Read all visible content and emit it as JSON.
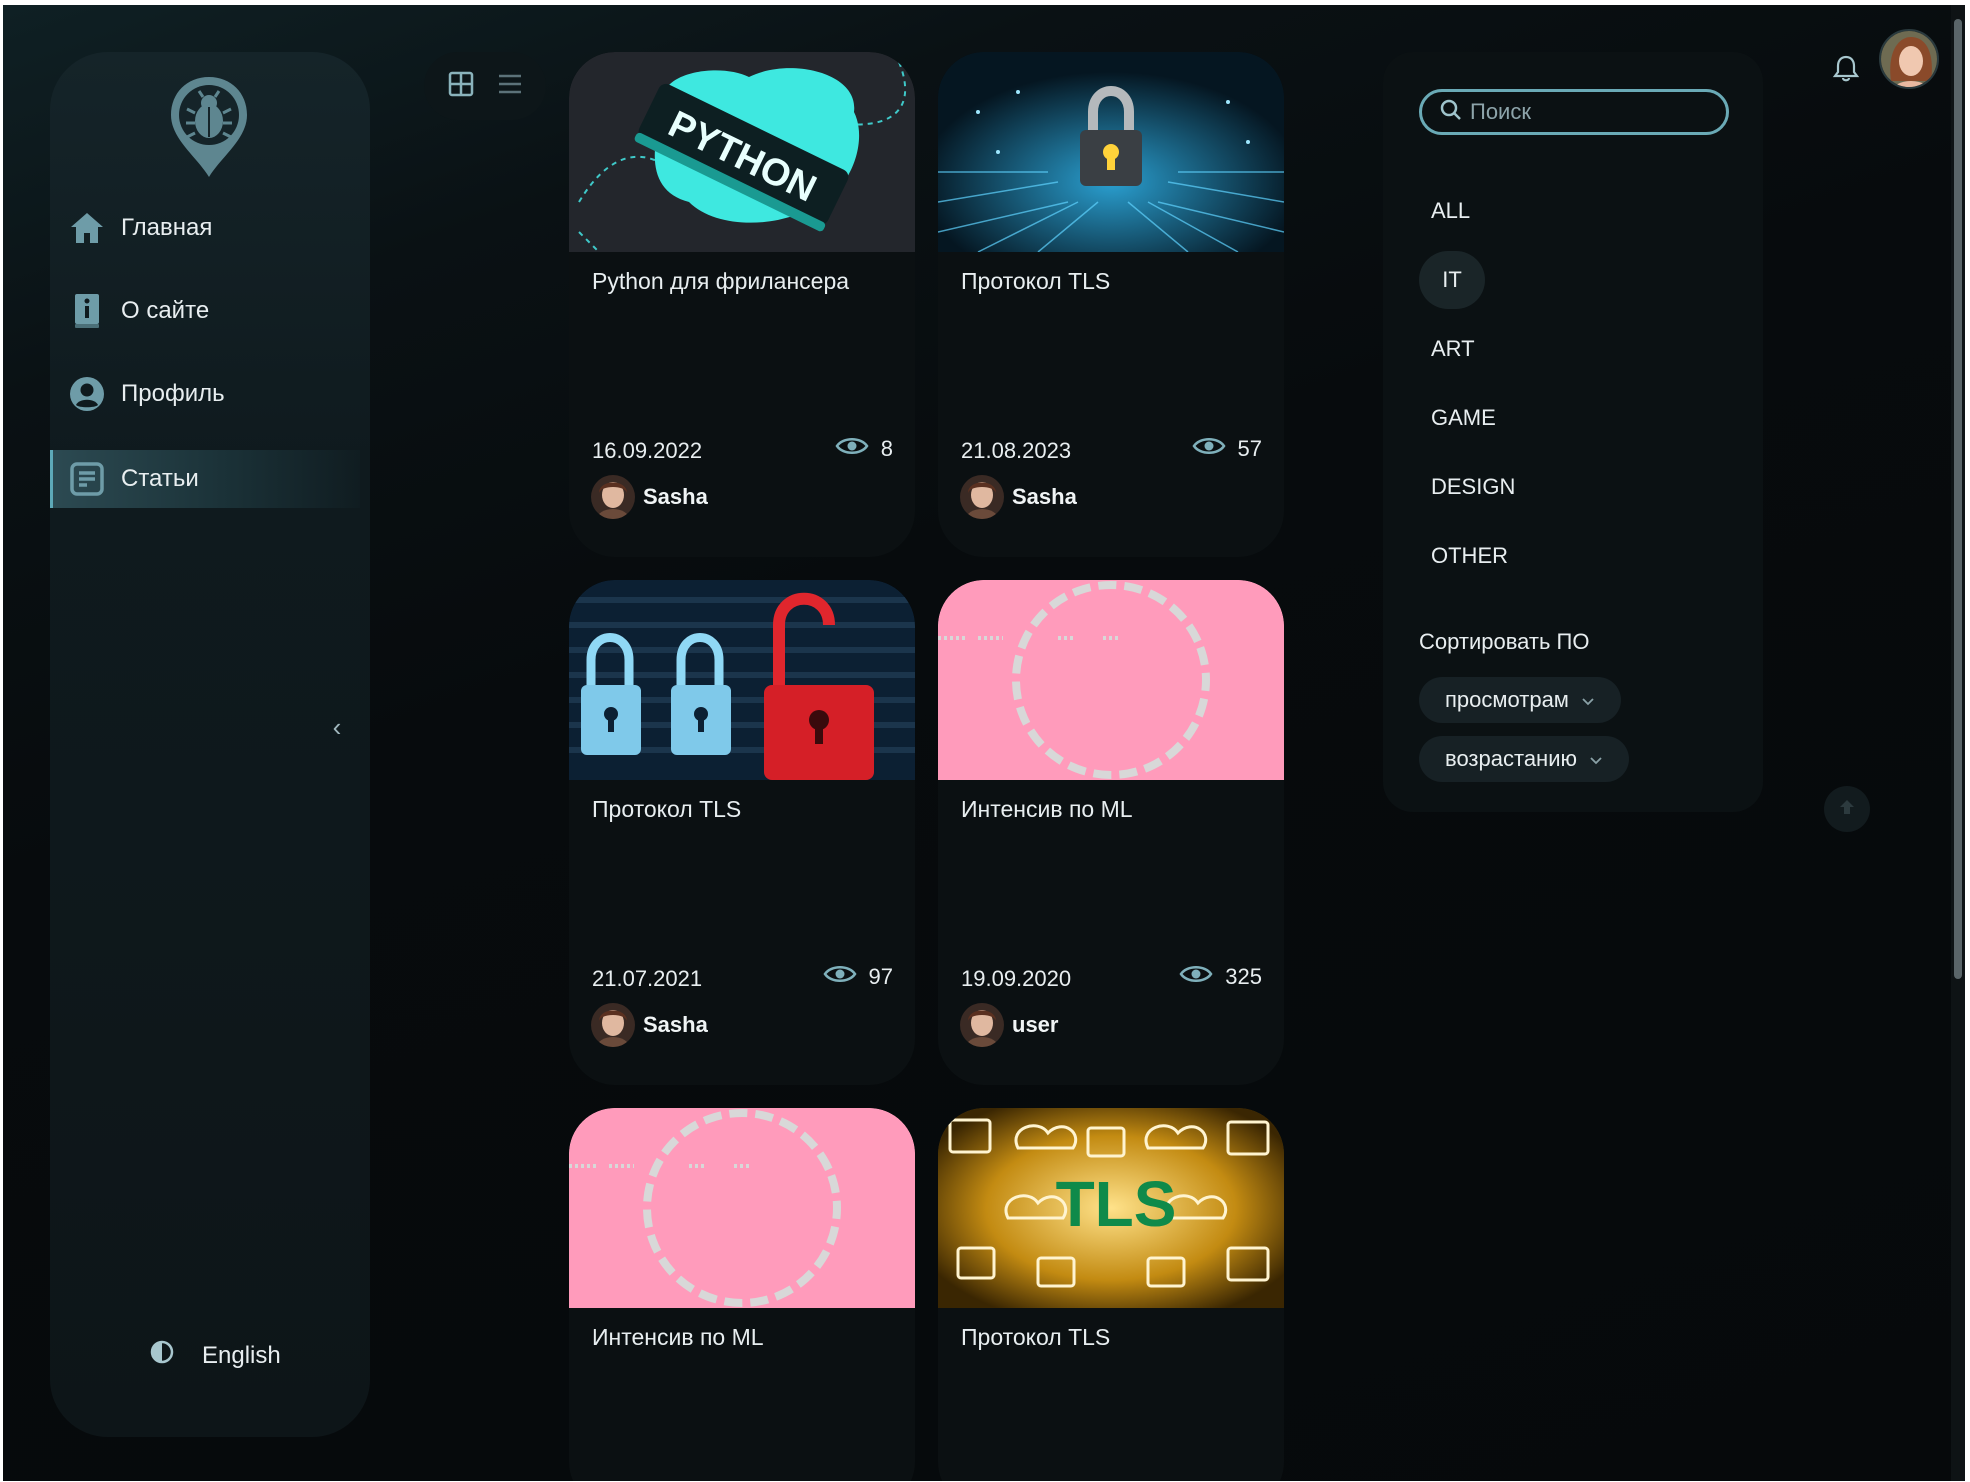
{
  "sidebar": {
    "logo_icon": "bug-icon",
    "items": [
      {
        "label": "Главная",
        "icon": "home-icon"
      },
      {
        "label": "О сайте",
        "icon": "info-book-icon"
      },
      {
        "label": "Профиль",
        "icon": "user-circle-icon"
      },
      {
        "label": "Статьи",
        "icon": "article-icon",
        "active": true
      }
    ],
    "collapse_glyph": "‹",
    "language_label": "English",
    "theme_icon": "theme-toggle-icon"
  },
  "view_switch": {
    "grid_icon": "grid-view-icon",
    "list_icon": "list-view-icon"
  },
  "articles": [
    {
      "title": "Python для фрилансера",
      "date": "16.09.2022",
      "views": "8",
      "author": "Sasha",
      "image": "python"
    },
    {
      "title": "Протокол TLS",
      "date": "21.08.2023",
      "views": "57",
      "author": "Sasha",
      "image": "padlock-circuit"
    },
    {
      "title": "Протокол TLS",
      "date": "21.07.2021",
      "views": "97",
      "author": "Sasha",
      "image": "padlocks"
    },
    {
      "title": "Интенсив по ML",
      "date": "19.09.2020",
      "views": "325",
      "author": "user",
      "image": "pink-loader"
    },
    {
      "title": "Интенсив по ML",
      "date": "",
      "views": "",
      "author": "",
      "image": "pink-loader"
    },
    {
      "title": "Протокол TLS",
      "date": "",
      "views": "",
      "author": "",
      "image": "tls-cloud"
    }
  ],
  "image_text": {
    "python": "PYTHON",
    "tls": "TLS"
  },
  "filters": {
    "search_placeholder": "Поиск",
    "tabs": [
      {
        "label": "ALL"
      },
      {
        "label": "IT",
        "active": true
      },
      {
        "label": "ART"
      },
      {
        "label": "GAME"
      },
      {
        "label": "DESIGN"
      },
      {
        "label": "OTHER"
      }
    ],
    "sort_label": "Сортировать ПО",
    "sort_field": "просмотрам",
    "sort_order": "возрастанию"
  },
  "colors": {
    "accent": "#5da9b8",
    "background": "#070b0d",
    "panel": "#0b1113",
    "pink_image": "#ff9bbb"
  }
}
